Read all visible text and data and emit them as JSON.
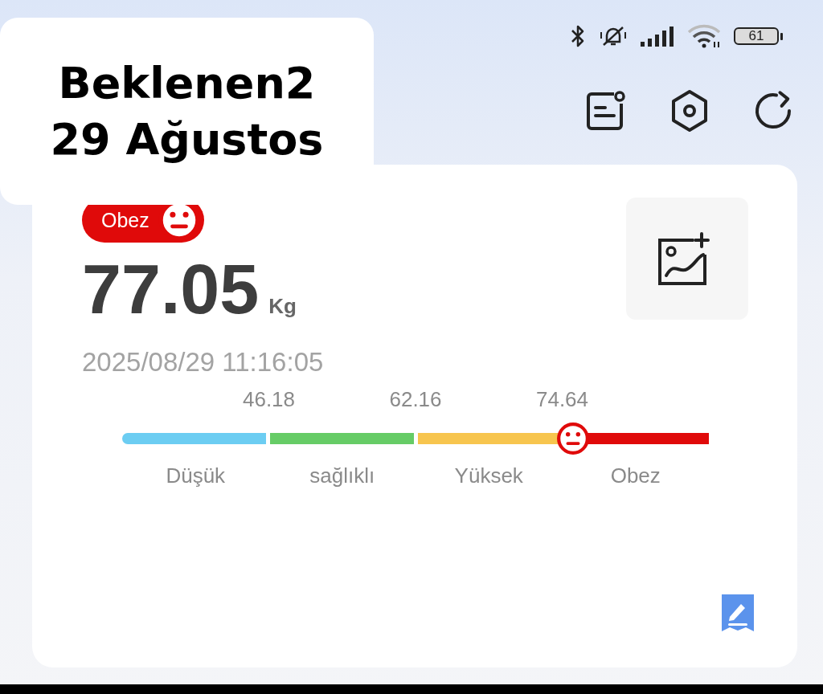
{
  "note_overlay": {
    "lines": [
      "Beklenen2",
      "29 Ağustos"
    ]
  },
  "status_bar": {
    "battery": "61"
  },
  "badge": {
    "label": "Obez",
    "color": "#e00a0a"
  },
  "weight": {
    "value": "77.05",
    "unit": "Kg"
  },
  "timestamp": "2025/08/29 11:16:05",
  "scale": {
    "ticks": [
      "46.18",
      "62.16",
      "74.64"
    ],
    "level": 0.768,
    "segments": [
      {
        "label": "Düşük",
        "color": "#6ccdf2"
      },
      {
        "label": "sağlıklı",
        "color": "#66cc66"
      },
      {
        "label": "Yüksek",
        "color": "#f7c54e"
      },
      {
        "label": "Obez",
        "color": "#e00a0a"
      }
    ]
  }
}
